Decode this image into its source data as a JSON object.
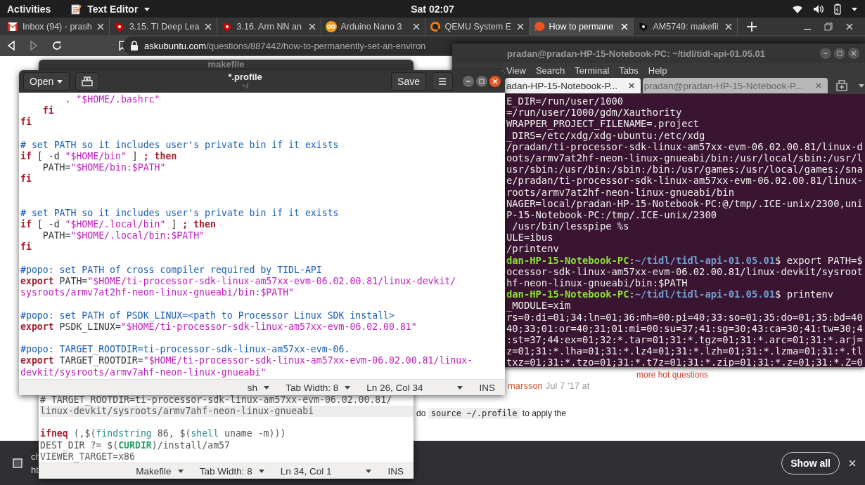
{
  "top_bar": {
    "activities": "Activities",
    "app_menu": "Text Editor",
    "clock": "Sat 02:07"
  },
  "browser": {
    "tabs": [
      {
        "label": "Inbox (94) - prash",
        "kind": "mail",
        "selected": false
      },
      {
        "label": "3.15. TI Deep Lea",
        "kind": "emblem",
        "selected": false
      },
      {
        "label": "3.16. Arm NN an",
        "kind": "emblem",
        "selected": false
      },
      {
        "label": "Arduino Nano 3",
        "kind": "infinity",
        "selected": false
      },
      {
        "label": "QEMU System E",
        "kind": "ring",
        "selected": false
      },
      {
        "label": "How to permane",
        "kind": "bubble",
        "selected": true
      },
      {
        "label": "AM5749: makefil",
        "kind": "emblem-dark",
        "selected": false
      }
    ],
    "url": {
      "host": "askubuntu.com",
      "path": "/questions/887442/how-to-permanently-set-an-environ"
    },
    "page": {
      "hot_questions_link": "more hot questions",
      "comment_author": "marsson",
      "comment_date": "Jul 7 '17 at",
      "answer_before": "do",
      "answer_code": "source ~/.profile",
      "answer_after": "to apply the"
    }
  },
  "downloads": {
    "item_line_1": "ch",
    "item_line_2": "ht",
    "show_all": "Show all"
  },
  "makefile_window": {
    "title": "makefile",
    "lines": [
      {
        "kind": "code",
        "current": false,
        "segments": [
          {
            "text": "# TARGET_ROOTDIR=ti-processor-sdk-linux-am57xx-evm-06.02.00.81/",
            "kind": "plain"
          }
        ]
      },
      {
        "kind": "code",
        "current": true,
        "segments": [
          {
            "text": "linux-devkit/sysroots/armv7ahf-neon-linux-gnueabi",
            "kind": "plain"
          }
        ]
      },
      {
        "kind": "blank"
      },
      {
        "kind": "code",
        "current": false,
        "segments": [
          {
            "text": "ifneq",
            "kind": "keyword"
          },
          {
            "text": " (,$(",
            "kind": "plain"
          },
          {
            "text": "findstring",
            "kind": "function"
          },
          {
            "text": " 86, $(",
            "kind": "plain"
          },
          {
            "text": "shell",
            "kind": "function"
          },
          {
            "text": " uname -m)))",
            "kind": "plain"
          }
        ]
      },
      {
        "kind": "code",
        "current": false,
        "segments": [
          {
            "text": "DEST_DIR ?= $(",
            "kind": "plain"
          },
          {
            "text": "CURDIR",
            "kind": "variable"
          },
          {
            "text": ")/install/am57",
            "kind": "plain"
          }
        ]
      },
      {
        "kind": "code",
        "current": false,
        "segments": [
          {
            "text": "VIEWER_TARGET=x86",
            "kind": "plain"
          }
        ]
      }
    ],
    "status": {
      "language": "Makefile",
      "tab_width": "Tab Width: 8",
      "position": "Ln 34, Col 1",
      "mode": "INS"
    }
  },
  "profile_window": {
    "open_button": "Open",
    "title": "*.profile",
    "subtitle": "~/",
    "save_button": "Save",
    "lines": [
      {
        "kind": "code",
        "segments": [
          {
            "text": "        . ",
            "kind": "plain"
          },
          {
            "text": "\"$HOME/.bashrc\"",
            "kind": "string"
          }
        ]
      },
      {
        "kind": "code",
        "segments": [
          {
            "text": "    fi",
            "kind": "keyword"
          }
        ]
      },
      {
        "kind": "code",
        "segments": [
          {
            "text": "fi",
            "kind": "keyword"
          }
        ]
      },
      {
        "kind": "blank"
      },
      {
        "kind": "code",
        "segments": [
          {
            "text": "# set PATH so it includes user's private bin if it exists",
            "kind": "comment"
          }
        ]
      },
      {
        "kind": "code",
        "segments": [
          {
            "text": "if",
            "kind": "keyword"
          },
          {
            "text": " [ -d ",
            "kind": "plain"
          },
          {
            "text": "\"$HOME/bin\"",
            "kind": "string"
          },
          {
            "text": " ] ",
            "kind": "plain"
          },
          {
            "text": "; then",
            "kind": "keyword"
          }
        ]
      },
      {
        "kind": "code",
        "segments": [
          {
            "text": "    PATH=",
            "kind": "plain"
          },
          {
            "text": "\"$HOME/bin:$PATH\"",
            "kind": "string"
          }
        ]
      },
      {
        "kind": "code",
        "segments": [
          {
            "text": "fi",
            "kind": "keyword"
          }
        ]
      },
      {
        "kind": "blank"
      },
      {
        "kind": "blank"
      },
      {
        "kind": "code",
        "segments": [
          {
            "text": "# set PATH so it includes user's private bin if it exists",
            "kind": "comment"
          }
        ]
      },
      {
        "kind": "code",
        "segments": [
          {
            "text": "if",
            "kind": "keyword"
          },
          {
            "text": " [ -d ",
            "kind": "plain"
          },
          {
            "text": "\"$HOME/.local/bin\"",
            "kind": "string"
          },
          {
            "text": " ] ",
            "kind": "plain"
          },
          {
            "text": "; then",
            "kind": "keyword"
          }
        ]
      },
      {
        "kind": "code",
        "segments": [
          {
            "text": "    PATH=",
            "kind": "plain"
          },
          {
            "text": "\"$HOME/.local/bin:$PATH\"",
            "kind": "string"
          }
        ]
      },
      {
        "kind": "code",
        "segments": [
          {
            "text": "fi",
            "kind": "keyword"
          }
        ]
      },
      {
        "kind": "blank"
      },
      {
        "kind": "code",
        "segments": [
          {
            "text": "#popo: set PATH of cross compiler required by TIDL-API",
            "kind": "comment"
          }
        ]
      },
      {
        "kind": "code",
        "segments": [
          {
            "text": "export",
            "kind": "keyword"
          },
          {
            "text": " PATH=",
            "kind": "plain"
          },
          {
            "text": "\"$HOME/ti-processor-sdk-linux-am57xx-evm-06.02.00.81/linux-devkit/",
            "kind": "string"
          }
        ]
      },
      {
        "kind": "code",
        "segments": [
          {
            "text": "sysroots/armv7at2hf-neon-linux-gnueabi/bin:$PATH\"",
            "kind": "string"
          }
        ]
      },
      {
        "kind": "blank"
      },
      {
        "kind": "code",
        "segments": [
          {
            "text": "#popo: set PATH of PSDK_LINUX=<path to Processor Linux SDK install>",
            "kind": "comment"
          }
        ]
      },
      {
        "kind": "code",
        "segments": [
          {
            "text": "export",
            "kind": "keyword"
          },
          {
            "text": " PSDK_LINUX=",
            "kind": "plain"
          },
          {
            "text": "\"$HOME/ti-processor-sdk-linux-am57xx-evm-06.02.00.81\"",
            "kind": "string"
          }
        ]
      },
      {
        "kind": "blank"
      },
      {
        "kind": "code",
        "segments": [
          {
            "text": "#popo: TARGET_ROOTDIR=ti-processor-sdk-linux-am57xx-evm-06.",
            "kind": "comment"
          }
        ]
      },
      {
        "kind": "code",
        "segments": [
          {
            "text": "export",
            "kind": "keyword"
          },
          {
            "text": " TARGET_ROOTDIR=",
            "kind": "plain"
          },
          {
            "text": "\"$HOME/ti-processor-sdk-linux-am57xx-evm-06.02.00.81/linux-",
            "kind": "string"
          }
        ]
      },
      {
        "kind": "code",
        "segments": [
          {
            "text": "devkit/sysroots/armv7ahf-neon-linux-gnueabi\"",
            "kind": "string"
          }
        ]
      }
    ],
    "status": {
      "language": "sh",
      "tab_width": "Tab Width: 8",
      "position": "Ln 26, Col 34",
      "mode": "INS"
    }
  },
  "terminal_window": {
    "title": "pradan@pradan-HP-15-Notebook-PC: ~/tidl/tidl-api-01.05.01",
    "menu": [
      "View",
      "Search",
      "Terminal",
      "Tabs",
      "Help"
    ],
    "tabs": [
      {
        "label": "adan-HP-15-Notebook-P...",
        "selected": true
      },
      {
        "label": "pradan@pradan-HP-15-Notebook-P...",
        "selected": false
      }
    ],
    "lines": [
      [
        {
          "text": "E_DIR=/run/user/1000",
          "kind": "plain"
        }
      ],
      [
        {
          "text": "=/run/user/1000/gdm/Xauthority",
          "kind": "plain"
        }
      ],
      [
        {
          "text": "WRAPPER_PROJECT_FILENAME=.project",
          "kind": "plain"
        }
      ],
      [
        {
          "text": "_DIRS=/etc/xdg/xdg-ubuntu:/etc/xdg",
          "kind": "plain"
        }
      ],
      [
        {
          "text": "/pradan/ti-processor-sdk-linux-am57xx-evm-06.02.00.81/linux-d",
          "kind": "plain"
        }
      ],
      [
        {
          "text": "oots/armv7at2hf-neon-linux-gnueabi/bin:/usr/local/sbin:/usr/l",
          "kind": "plain"
        }
      ],
      [
        {
          "text": "usr/sbin:/usr/bin:/sbin:/bin:/usr/games:/usr/local/games:/sna",
          "kind": "plain"
        }
      ],
      [
        {
          "text": "e/pradan/ti-processor-sdk-linux-am57xx-evm-06.02.00.81/linux-",
          "kind": "plain"
        }
      ],
      [
        {
          "text": "roots/armv7at2hf-neon-linux-gnueabi/bin",
          "kind": "plain"
        }
      ],
      [
        {
          "text": "NAGER=local/pradan-HP-15-Notebook-PC:@/tmp/.ICE-unix/2300,uni",
          "kind": "plain"
        }
      ],
      [
        {
          "text": "P-15-Notebook-PC:/tmp/.ICE-unix/2300",
          "kind": "plain"
        }
      ],
      [
        {
          "text": " /usr/bin/lesspipe %s",
          "kind": "plain"
        }
      ],
      [
        {
          "text": "ULE=ibus",
          "kind": "plain"
        }
      ],
      [
        {
          "text": "/printenv",
          "kind": "plain"
        }
      ],
      [
        {
          "text": "dan-HP-15-Notebook-PC",
          "kind": "user"
        },
        {
          "text": ":",
          "kind": "plain"
        },
        {
          "text": "~/tidl/tidl-api-01.05.01",
          "kind": "path"
        },
        {
          "text": "$ export PATH=$",
          "kind": "plain"
        }
      ],
      [
        {
          "text": "ocessor-sdk-linux-am57xx-evm-06.02.00.81/linux-devkit/sysroot",
          "kind": "plain"
        }
      ],
      [
        {
          "text": "hf-neon-linux-gnueabi/bin:$PATH",
          "kind": "plain"
        }
      ],
      [
        {
          "text": "dan-HP-15-Notebook-PC",
          "kind": "user"
        },
        {
          "text": ":",
          "kind": "plain"
        },
        {
          "text": "~/tidl/tidl-api-01.05.01",
          "kind": "path"
        },
        {
          "text": "$ printenv",
          "kind": "plain"
        }
      ],
      [
        {
          "text": "_MODULE=xim",
          "kind": "plain"
        }
      ],
      [
        {
          "text": "rs=0:di=01;34:ln=01;36:mh=00:pi=40;33:so=01;35:do=01;35:bd=40",
          "kind": "plain"
        }
      ],
      [
        {
          "text": "40;33;01:or=40;31;01:mi=00:su=37;41:sg=30;43:ca=30;41:tw=30;4",
          "kind": "plain"
        }
      ],
      [
        {
          "text": ":st=37;44:ex=01;32:*.tar=01;31:*.tgz=01;31:*.arc=01;31:*.arj=",
          "kind": "plain"
        }
      ],
      [
        {
          "text": "z=01;31:*.lha=01;31:*.lz4=01;31:*.lzh=01;31:*.lzma=01;31:*.tl",
          "kind": "plain"
        }
      ],
      [
        {
          "text": "txz=01;31:*.tzo=01;31:*.t7z=01;31:*.zip=01;31:*.z=01;31:*.Z=0",
          "kind": "plain"
        }
      ]
    ]
  }
}
